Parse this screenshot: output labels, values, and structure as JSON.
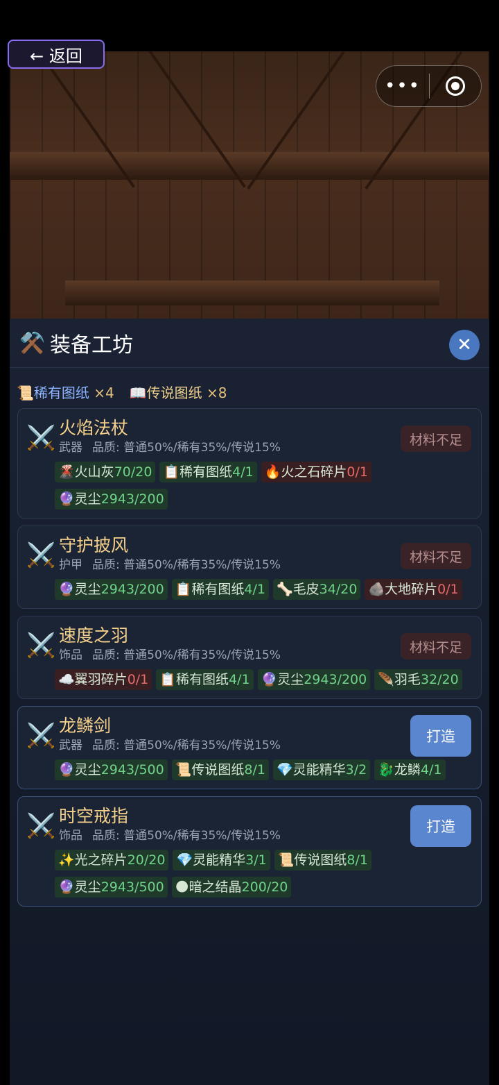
{
  "nav": {
    "back_label": "← 返回"
  },
  "capsule": {
    "more_label": "•••"
  },
  "panel": {
    "title": "装备工坊",
    "icon": "⚒️",
    "close_label": "✕"
  },
  "inventory": [
    {
      "icon": "📜",
      "name": "稀有图纸",
      "count": "×4"
    },
    {
      "icon": "📖",
      "name": "传说图纸",
      "count": "×8"
    }
  ],
  "recipes": [
    {
      "name": "火焰法杖",
      "kind": "武器",
      "quality": "品质: 普通50%/稀有35%/传说15%",
      "status": "材料不足",
      "can_forge": false,
      "materials": [
        {
          "icon": "🌋",
          "name": "火山灰",
          "qty": "70/20",
          "enough": true
        },
        {
          "icon": "📋",
          "name": "稀有图纸",
          "qty": "4/1",
          "enough": true
        },
        {
          "icon": "🔥",
          "name": "火之石碎片",
          "qty": "0/1",
          "enough": false
        },
        {
          "icon": "🔮",
          "name": "灵尘",
          "qty": "2943/200",
          "enough": true
        }
      ]
    },
    {
      "name": "守护披风",
      "kind": "护甲",
      "quality": "品质: 普通50%/稀有35%/传说15%",
      "status": "材料不足",
      "can_forge": false,
      "materials": [
        {
          "icon": "🔮",
          "name": "灵尘",
          "qty": "2943/200",
          "enough": true
        },
        {
          "icon": "📋",
          "name": "稀有图纸",
          "qty": "4/1",
          "enough": true
        },
        {
          "icon": "🦴",
          "name": "毛皮",
          "qty": "34/20",
          "enough": true
        },
        {
          "icon": "🪨",
          "name": "大地碎片",
          "qty": "0/1",
          "enough": false
        }
      ]
    },
    {
      "name": "速度之羽",
      "kind": "饰品",
      "quality": "品质: 普通50%/稀有35%/传说15%",
      "status": "材料不足",
      "can_forge": false,
      "materials": [
        {
          "icon": "☁️",
          "name": "翼羽碎片",
          "qty": "0/1",
          "enough": false
        },
        {
          "icon": "📋",
          "name": "稀有图纸",
          "qty": "4/1",
          "enough": true
        },
        {
          "icon": "🔮",
          "name": "灵尘",
          "qty": "2943/200",
          "enough": true
        },
        {
          "icon": "🪶",
          "name": "羽毛",
          "qty": "32/20",
          "enough": true
        }
      ]
    },
    {
      "name": "龙鳞剑",
      "kind": "武器",
      "quality": "品质: 普通50%/稀有35%/传说15%",
      "status": "打造",
      "can_forge": true,
      "materials": [
        {
          "icon": "🔮",
          "name": "灵尘",
          "qty": "2943/500",
          "enough": true
        },
        {
          "icon": "📜",
          "name": "传说图纸",
          "qty": "8/1",
          "enough": true
        },
        {
          "icon": "💎",
          "name": "灵能精华",
          "qty": "3/2",
          "enough": true
        },
        {
          "icon": "🐉",
          "name": "龙鳞",
          "qty": "4/1",
          "enough": true
        }
      ]
    },
    {
      "name": "时空戒指",
      "kind": "饰品",
      "quality": "品质: 普通50%/稀有35%/传说15%",
      "status": "打造",
      "can_forge": true,
      "materials": [
        {
          "icon": "✨",
          "name": "光之碎片",
          "qty": "20/20",
          "enough": true
        },
        {
          "icon": "💎",
          "name": "灵能精华",
          "qty": "3/1",
          "enough": true
        },
        {
          "icon": "📜",
          "name": "传说图纸",
          "qty": "8/1",
          "enough": true
        },
        {
          "icon": "🔮",
          "name": "灵尘",
          "qty": "2943/500",
          "enough": true
        },
        {
          "icon": "🌑",
          "name": "暗之结晶",
          "qty": "200/20",
          "enough": true
        }
      ]
    }
  ]
}
